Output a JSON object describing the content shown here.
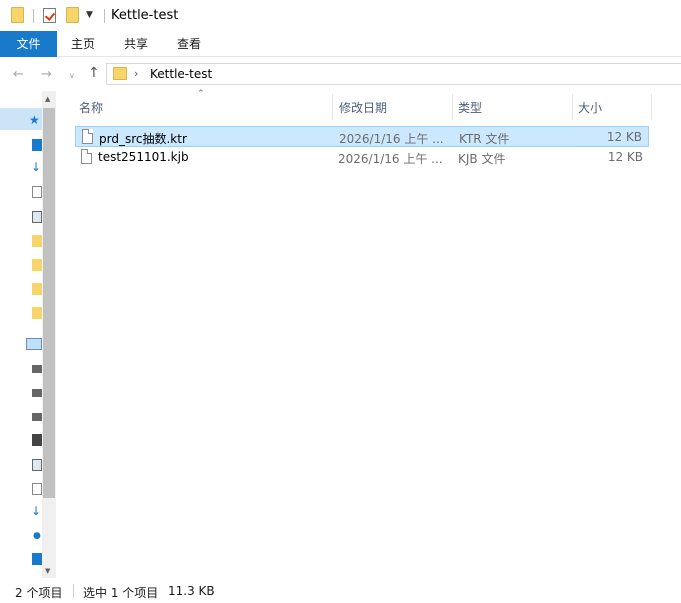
{
  "window": {
    "title": "Kettle-test"
  },
  "ribbon": {
    "tabs": [
      "文件",
      "主页",
      "共享",
      "查看"
    ]
  },
  "address": {
    "path": "Kettle-test"
  },
  "columns": {
    "name": "名称",
    "modified": "修改日期",
    "type": "类型",
    "size": "大小"
  },
  "files": [
    {
      "name": "prd_src抽数.ktr",
      "modified": "2026/1/16 上午 ...",
      "type": "KTR 文件",
      "size": "12 KB",
      "selected": true
    },
    {
      "name": "test251101.kjb",
      "modified": "2026/1/16 上午 ...",
      "type": "KJB 文件",
      "size": "12 KB",
      "selected": false
    }
  ],
  "status": {
    "item_count": "2 个项目",
    "selection": "选中 1 个项目",
    "selection_size": "11.3 KB"
  },
  "colors": {
    "accent": "#1979ca",
    "selection_bg": "#cce8ff",
    "selection_border": "#99d1ff",
    "folder": "#f7d56a"
  }
}
